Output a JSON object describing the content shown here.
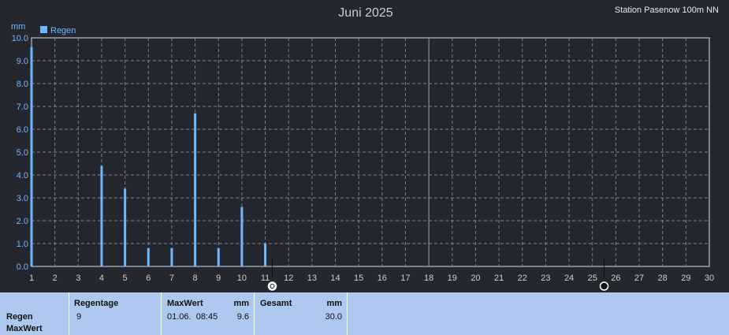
{
  "header": {
    "title": "Juni 2025",
    "station": "Station Pasenow 100m NN"
  },
  "chart_data": {
    "type": "bar",
    "title": "Juni 2025",
    "ylabel": "mm",
    "ylim": [
      0,
      10
    ],
    "yticks": [
      "0.0",
      "1.0",
      "2.0",
      "3.0",
      "4.0",
      "5.0",
      "6.0",
      "7.0",
      "8.0",
      "9.0",
      "10.0"
    ],
    "xlim": [
      1,
      30
    ],
    "xticks": [
      "1",
      "2",
      "3",
      "4",
      "5",
      "6",
      "7",
      "8",
      "9",
      "10",
      "11",
      "12",
      "13",
      "14",
      "15",
      "16",
      "17",
      "18",
      "19",
      "20",
      "21",
      "22",
      "23",
      "24",
      "25",
      "26",
      "27",
      "28",
      "29",
      "30"
    ],
    "grid": true,
    "legend": "top-left",
    "series": [
      {
        "name": "Regen",
        "color": "#6fb6ff",
        "points": [
          {
            "x": 1,
            "y": 9.6
          },
          {
            "x": 4,
            "y": 4.4
          },
          {
            "x": 5,
            "y": 3.4
          },
          {
            "x": 6,
            "y": 0.8
          },
          {
            "x": 7,
            "y": 0.8
          },
          {
            "x": 8,
            "y": 6.7
          },
          {
            "x": 9,
            "y": 0.8
          },
          {
            "x": 10,
            "y": 2.6
          },
          {
            "x": 11,
            "y": 1.0
          }
        ]
      }
    ],
    "markers": [
      {
        "icon": "moon-full-icon",
        "x": 11.3
      },
      {
        "icon": "moon-new-icon",
        "x": 25.5
      }
    ]
  },
  "stats": {
    "row_label": "Regen",
    "row_sublabel": "MaxWert",
    "regentage_label": "Regentage",
    "regentage_value": "9",
    "maxwert_label": "MaxWert",
    "maxwert_unit": "mm",
    "maxwert_date": "01.06.  08:45",
    "maxwert_value": "9.6",
    "gesamt_label": "Gesamt",
    "gesamt_unit": "mm",
    "gesamt_value": "30.0"
  }
}
